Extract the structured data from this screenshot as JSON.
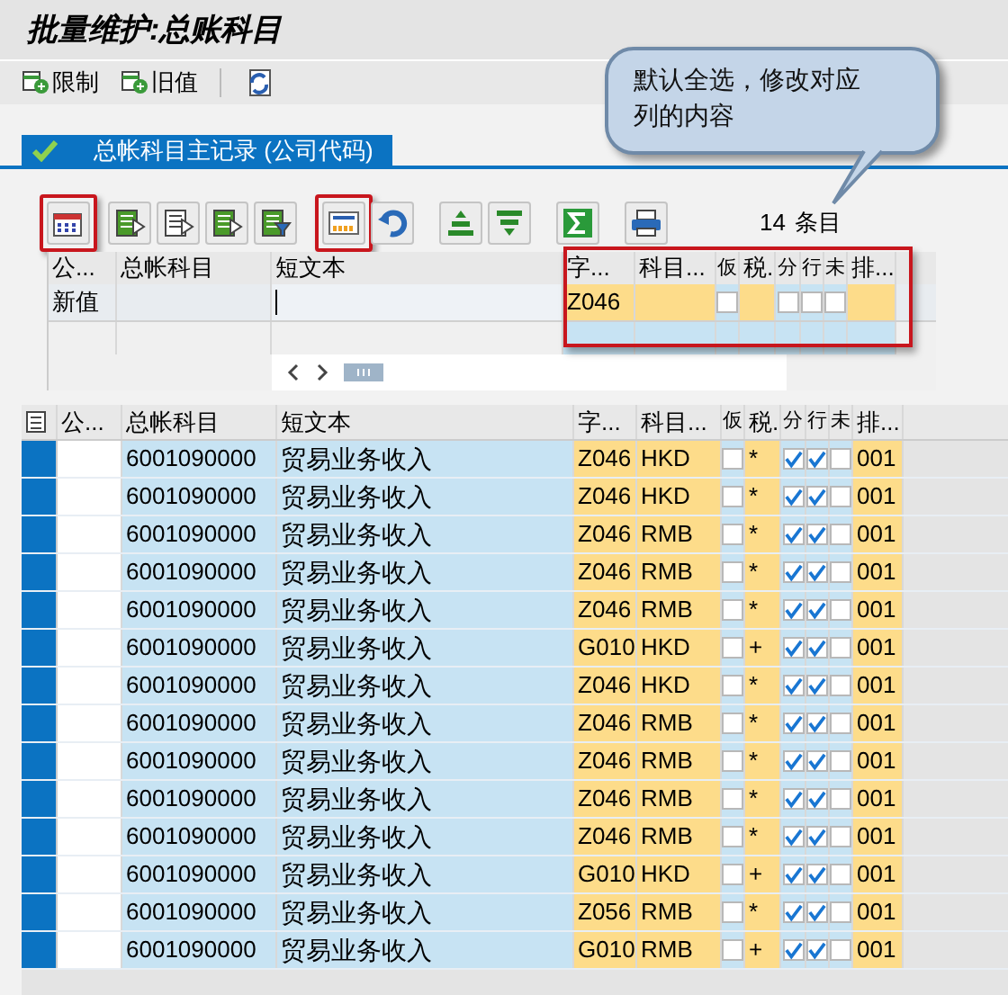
{
  "window": {
    "title": "批量维护:总账科目"
  },
  "toolbar": [
    {
      "kind": "add",
      "label": "限制"
    },
    {
      "kind": "add",
      "label": "旧值"
    },
    {
      "kind": "refresh"
    }
  ],
  "tab": {
    "label": "总帐科目主记录 (公司代码)",
    "selected": true
  },
  "callout": {
    "text": "默认全选，修改对应列的内容"
  },
  "alv_toolbar": {
    "buttons": [
      {
        "kind": "details",
        "highlighted": true
      },
      {
        "kind": "select-all",
        "highlighted": false
      },
      {
        "kind": "deselect",
        "highlighted": false
      },
      {
        "kind": "select-block",
        "highlighted": false
      },
      {
        "kind": "filter-select",
        "highlighted": false
      },
      {
        "kind": "mass-change",
        "highlighted": true
      },
      {
        "kind": "undo",
        "highlighted": false
      },
      {
        "kind": "sort-up",
        "highlighted": false
      },
      {
        "kind": "sort-down",
        "highlighted": false
      },
      {
        "kind": "sum",
        "highlighted": false
      },
      {
        "kind": "print",
        "highlighted": false
      }
    ],
    "count": "14",
    "count_label": "条目"
  },
  "table": {
    "columns": [
      "公...",
      "总帐科目",
      "短文本",
      "字...",
      "科目...",
      "仮",
      "税.",
      "分",
      "行",
      "未",
      "排..."
    ]
  },
  "edit_grid": {
    "columns": [
      "公...",
      "总帐科目",
      "短文本",
      "字...",
      "科目...",
      "仮",
      "税.",
      "分",
      "行",
      "未",
      "排..."
    ],
    "highlighted": true,
    "row_label": "新值",
    "field_status": "Z046",
    "flags": [
      false,
      false,
      false,
      false
    ]
  },
  "rows": [
    {
      "account": "6001090000",
      "text": "贸易业务收入",
      "field_status": "Z046",
      "currency": "HKD",
      "tax": "*",
      "flags": [
        false,
        true,
        true,
        false
      ],
      "sort": "001",
      "selected": true
    },
    {
      "account": "6001090000",
      "text": "贸易业务收入",
      "field_status": "Z046",
      "currency": "HKD",
      "tax": "*",
      "flags": [
        false,
        true,
        true,
        false
      ],
      "sort": "001",
      "selected": true
    },
    {
      "account": "6001090000",
      "text": "贸易业务收入",
      "field_status": "Z046",
      "currency": "RMB",
      "tax": "*",
      "flags": [
        false,
        true,
        true,
        false
      ],
      "sort": "001",
      "selected": true
    },
    {
      "account": "6001090000",
      "text": "贸易业务收入",
      "field_status": "Z046",
      "currency": "RMB",
      "tax": "*",
      "flags": [
        false,
        true,
        true,
        false
      ],
      "sort": "001",
      "selected": true
    },
    {
      "account": "6001090000",
      "text": "贸易业务收入",
      "field_status": "Z046",
      "currency": "RMB",
      "tax": "*",
      "flags": [
        false,
        true,
        true,
        false
      ],
      "sort": "001",
      "selected": true
    },
    {
      "account": "6001090000",
      "text": "贸易业务收入",
      "field_status": "G010",
      "currency": "HKD",
      "tax": "+",
      "flags": [
        false,
        true,
        true,
        false
      ],
      "sort": "001",
      "selected": true
    },
    {
      "account": "6001090000",
      "text": "贸易业务收入",
      "field_status": "Z046",
      "currency": "HKD",
      "tax": "*",
      "flags": [
        false,
        true,
        true,
        false
      ],
      "sort": "001",
      "selected": true
    },
    {
      "account": "6001090000",
      "text": "贸易业务收入",
      "field_status": "Z046",
      "currency": "RMB",
      "tax": "*",
      "flags": [
        false,
        true,
        true,
        false
      ],
      "sort": "001",
      "selected": true
    },
    {
      "account": "6001090000",
      "text": "贸易业务收入",
      "field_status": "Z046",
      "currency": "RMB",
      "tax": "*",
      "flags": [
        false,
        true,
        true,
        false
      ],
      "sort": "001",
      "selected": true
    },
    {
      "account": "6001090000",
      "text": "贸易业务收入",
      "field_status": "Z046",
      "currency": "RMB",
      "tax": "*",
      "flags": [
        false,
        true,
        true,
        false
      ],
      "sort": "001",
      "selected": true
    },
    {
      "account": "6001090000",
      "text": "贸易业务收入",
      "field_status": "Z046",
      "currency": "RMB",
      "tax": "*",
      "flags": [
        false,
        true,
        true,
        false
      ],
      "sort": "001",
      "selected": true
    },
    {
      "account": "6001090000",
      "text": "贸易业务收入",
      "field_status": "G010",
      "currency": "HKD",
      "tax": "+",
      "flags": [
        false,
        true,
        true,
        false
      ],
      "sort": "001",
      "selected": true
    },
    {
      "account": "6001090000",
      "text": "贸易业务收入",
      "field_status": "Z056",
      "currency": "RMB",
      "tax": "*",
      "flags": [
        false,
        true,
        true,
        false
      ],
      "sort": "001",
      "selected": true
    },
    {
      "account": "6001090000",
      "text": "贸易业务收入",
      "field_status": "G010",
      "currency": "RMB",
      "tax": "+",
      "flags": [
        false,
        true,
        true,
        false
      ],
      "sort": "001",
      "selected": true
    }
  ]
}
